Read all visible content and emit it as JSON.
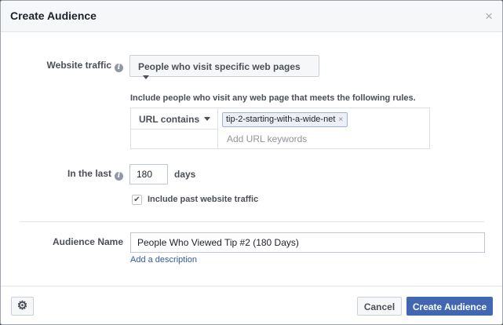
{
  "dialog": {
    "title": "Create Audience",
    "close_glyph": "×"
  },
  "website_traffic": {
    "label": "Website traffic",
    "info_glyph": "i",
    "selected": "People who visit specific web pages"
  },
  "rules": {
    "caption": "Include people who visit any web page that meets the following rules.",
    "operator": "URL contains",
    "tokens": [
      "tip-2-starting-with-a-wide-net"
    ],
    "token_remove_glyph": "×",
    "keyword_placeholder": "Add URL keywords"
  },
  "retention": {
    "label": "In the last",
    "info_glyph": "i",
    "value": "180",
    "unit": "days"
  },
  "past_traffic": {
    "checked": true,
    "check_glyph": "✔",
    "label": "Include past website traffic"
  },
  "audience_name": {
    "label": "Audience Name",
    "value": "People Who Viewed Tip #2 (180 Days)",
    "add_description": "Add a description"
  },
  "footer": {
    "settings_glyph": "⚙",
    "cancel_label": "Cancel",
    "create_label": "Create Audience",
    "primary_color": "#4267b2"
  }
}
